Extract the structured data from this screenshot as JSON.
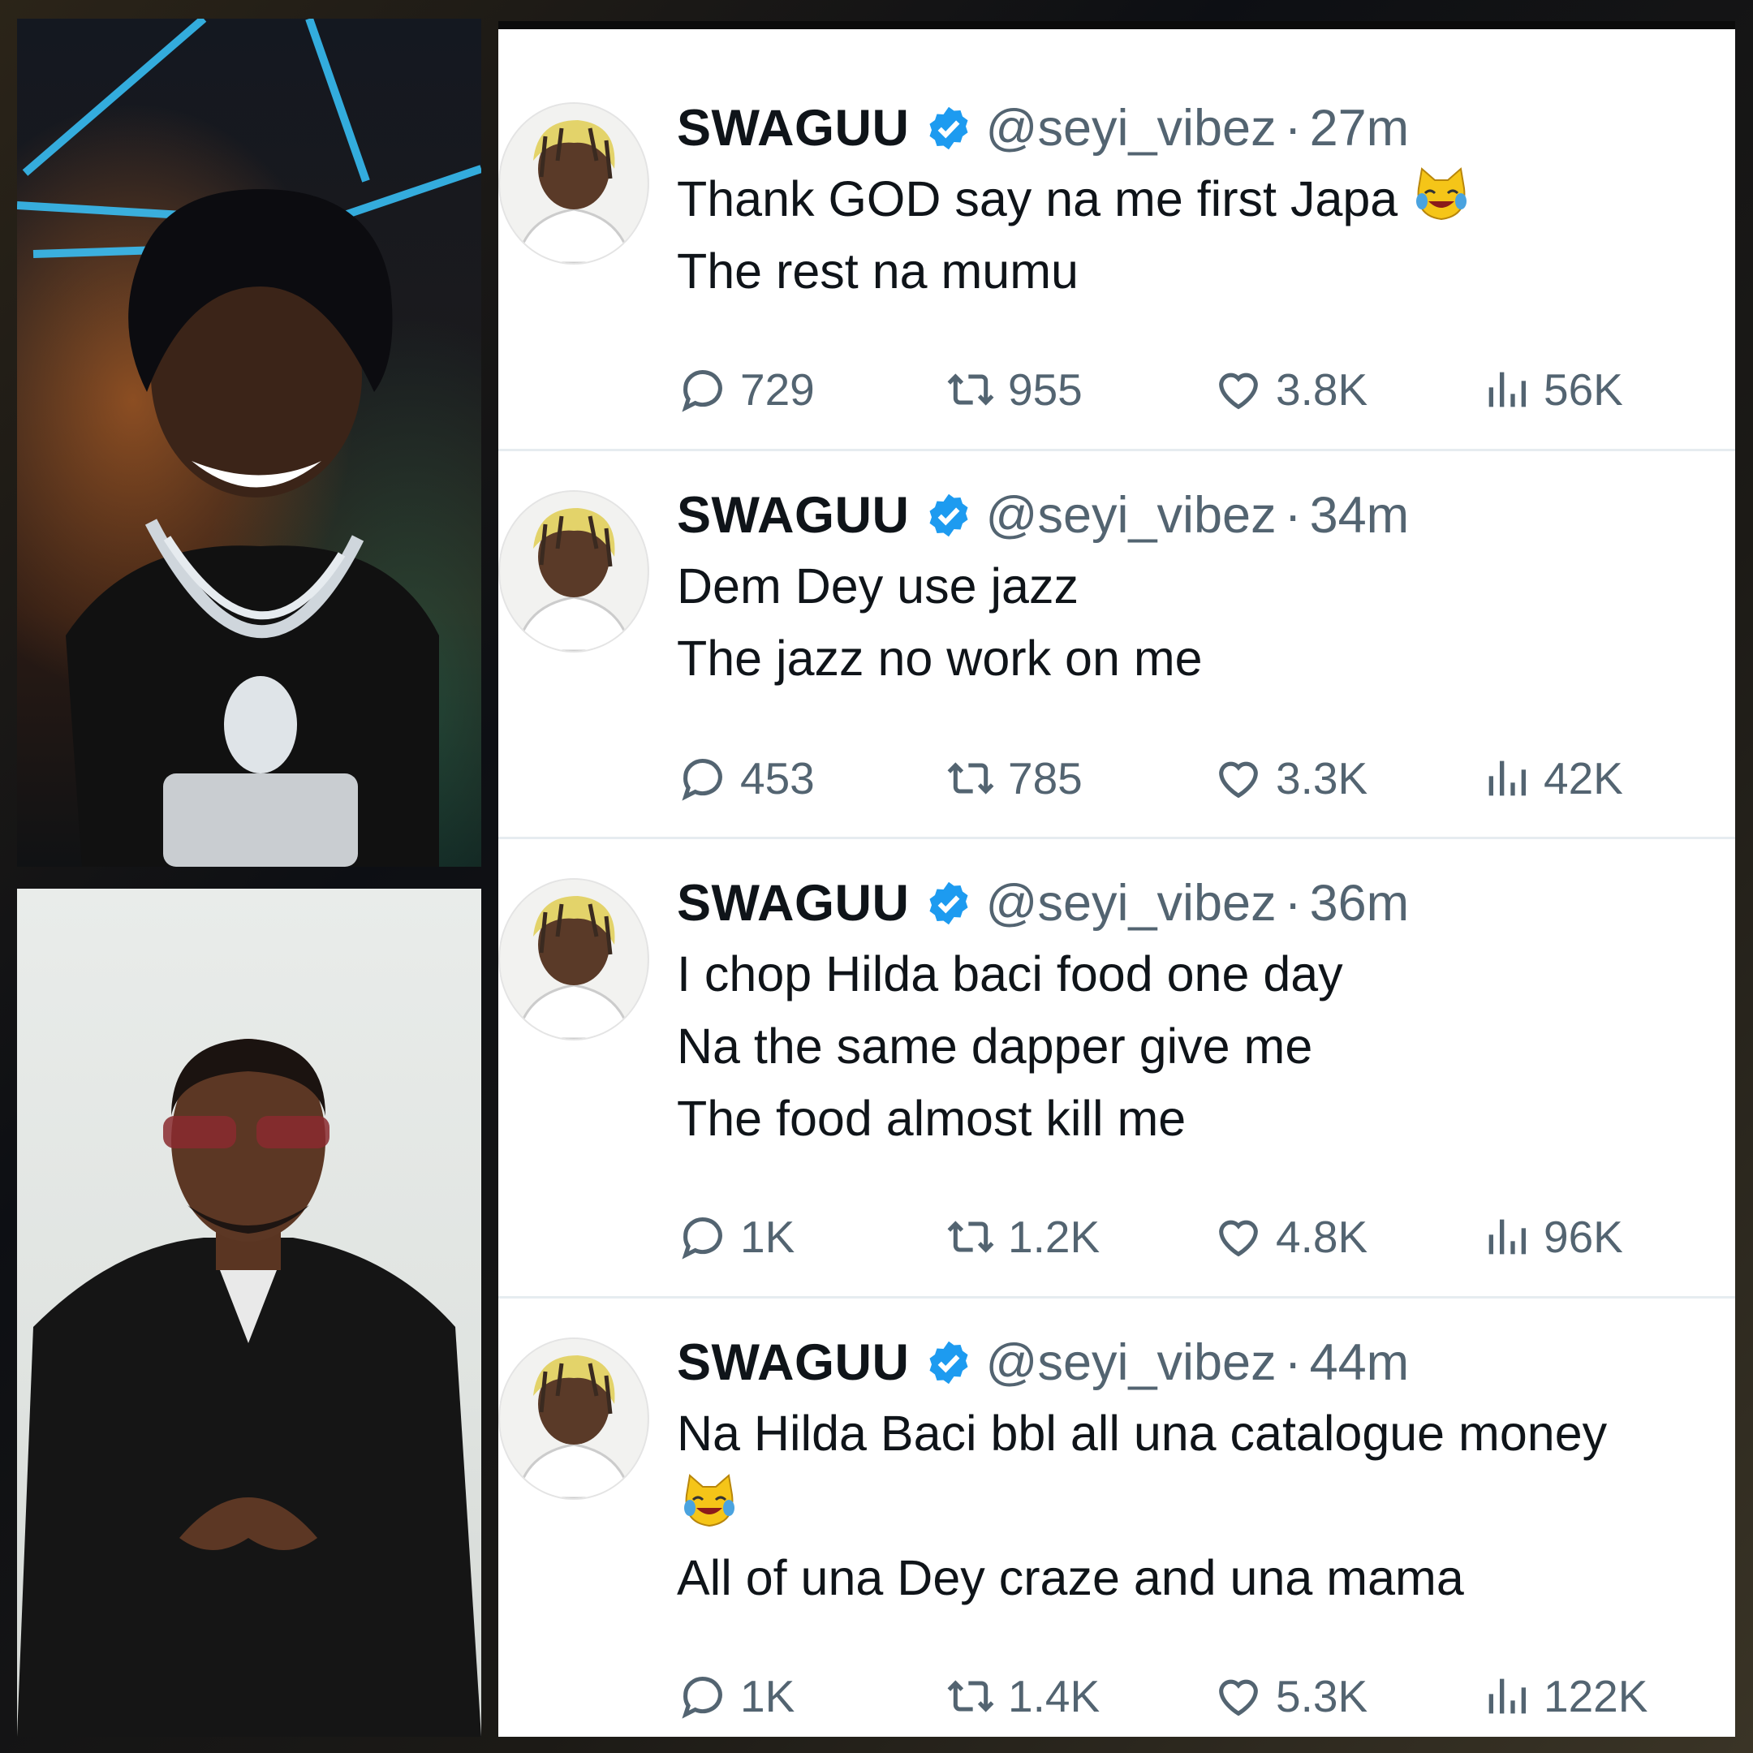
{
  "photos": [
    {
      "name": "photo-top"
    },
    {
      "name": "photo-bottom"
    }
  ],
  "icons": {
    "verified": "verified-badge-icon",
    "reply": "reply-bubble-icon",
    "retweet": "retweet-icon",
    "like": "heart-icon",
    "views": "views-bar-icon",
    "emoji": "cat-tears-of-joy-emoji"
  },
  "colors": {
    "verified_blue": "#1d9bf0",
    "text_primary": "#0f1419",
    "text_secondary": "#536471"
  },
  "tweets": [
    {
      "display_name": "SWAGUU",
      "handle": "@seyi_vibez",
      "time": "27m",
      "lines": [
        "Thank GOD say na me first Japa",
        "The rest na mumu"
      ],
      "replies": "729",
      "retweets": "955",
      "likes": "3.8K",
      "views": "56K"
    },
    {
      "display_name": "SWAGUU",
      "handle": "@seyi_vibez",
      "time": "34m",
      "lines": [
        "Dem Dey use jazz",
        "The jazz no work on me"
      ],
      "replies": "453",
      "retweets": "785",
      "likes": "3.3K",
      "views": "42K"
    },
    {
      "display_name": "SWAGUU",
      "handle": "@seyi_vibez",
      "time": "36m",
      "lines": [
        "I chop Hilda baci food one day",
        "Na the same dapper give me",
        "The food almost kill me"
      ],
      "replies": "1K",
      "retweets": "1.2K",
      "likes": "4.8K",
      "views": "96K"
    },
    {
      "display_name": "SWAGUU",
      "handle": "@seyi_vibez",
      "time": "44m",
      "lines": [
        "Na Hilda Baci bbl all una catalogue money",
        "",
        "All of una Dey craze and una mama"
      ],
      "replies": "1K",
      "retweets": "1.4K",
      "likes": "5.3K",
      "views": "122K"
    }
  ]
}
